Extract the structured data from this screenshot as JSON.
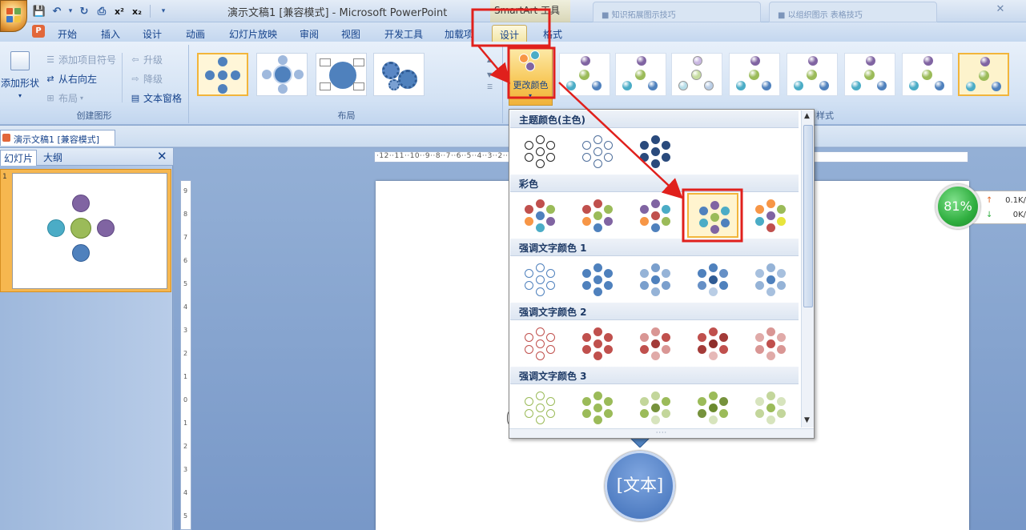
{
  "window": {
    "title": "演示文稿1 [兼容模式] - Microsoft PowerPoint",
    "contextual_title": "SmartArt 工具",
    "bg_tab_1": "■ 知识拓展图示技巧",
    "bg_tab_2": "■ 以组织图示 表格技巧",
    "close_glyph": "✕"
  },
  "qat": {
    "save": "💾",
    "undo": "↶",
    "redo": "↻",
    "superscript": "x²",
    "subscript": "x₂",
    "dropdown": "▾"
  },
  "office_logo_colors": [
    "#e05b2a",
    "#6aa84f",
    "#3d78c7",
    "#f3c340"
  ],
  "ppt_badge": "P",
  "tabs": [
    {
      "label": "开始"
    },
    {
      "label": "插入"
    },
    {
      "label": "设计"
    },
    {
      "label": "动画"
    },
    {
      "label": "幻灯片放映"
    },
    {
      "label": "审阅"
    },
    {
      "label": "视图"
    },
    {
      "label": "开发工具"
    },
    {
      "label": "加载项"
    },
    {
      "label": "设计"
    },
    {
      "label": "格式"
    }
  ],
  "ribbon": {
    "create_group": {
      "label": "创建图形",
      "add_shape": "添加形状",
      "add_bullet": "添加项目符号",
      "right_to_left": "从右向左",
      "layout": "布局",
      "promote": "升级",
      "demote": "降级",
      "text_pane": "文本窗格"
    },
    "layouts_group": {
      "label": "布局"
    },
    "styles_group": {
      "label": "SmartArt 样式",
      "label_visible": "样式"
    },
    "change_color": "更改颜色"
  },
  "document_tab": "演示文稿1 [兼容模式]",
  "pane": {
    "tab_slides": "幻灯片",
    "tab_outline": "大纲",
    "close": "✕",
    "slide_number": "1"
  },
  "ruler": {
    "horizontal": "·12··11··10··9··8··7··6··5··4··3··2··1··0··1··2··3··4··5··6··7··8··9··10··11··12·"
  },
  "slide": {
    "bubble_text": "[文本]"
  },
  "gallery": {
    "sections": [
      {
        "title": "主题颜色(主色)"
      },
      {
        "title": "彩色"
      },
      {
        "title": "强调文字颜色 1"
      },
      {
        "title": "强调文字颜色 2"
      },
      {
        "title": "强调文字颜色 3"
      }
    ],
    "palettes": {
      "theme": [
        {
          "center": "#ffffff",
          "ring": [
            "#ffffff",
            "#ffffff",
            "#ffffff",
            "#ffffff",
            "#ffffff",
            "#ffffff"
          ],
          "stroke": "#222222"
        },
        {
          "center": "#ffffff",
          "ring": [
            "#ffffff",
            "#ffffff",
            "#ffffff",
            "#ffffff",
            "#ffffff",
            "#ffffff"
          ],
          "stroke": "#4f6f9c"
        },
        {
          "center": "#2a4a7c",
          "ring": [
            "#2a4a7c",
            "#2a4a7c",
            "#2a4a7c",
            "#2a4a7c",
            "#2a4a7c",
            "#2a4a7c"
          ],
          "stroke": "#2a4a7c"
        }
      ],
      "colorful": [
        {
          "center": "#4f81bd",
          "ring": [
            "#c0504d",
            "#9bbb59",
            "#8064a2",
            "#4bacc6",
            "#f79646",
            "#c0504d"
          ],
          "stroke": "none"
        },
        {
          "center": "#9bbb59",
          "ring": [
            "#c0504d",
            "#9bbb59",
            "#8064a2",
            "#4f81bd",
            "#f79646",
            "#c0504d"
          ],
          "stroke": "none"
        },
        {
          "center": "#c0504d",
          "ring": [
            "#8064a2",
            "#4bacc6",
            "#9bbb59",
            "#4f81bd",
            "#f79646",
            "#8064a2"
          ],
          "stroke": "none"
        },
        {
          "center": "#9bbb59",
          "ring": [
            "#8064a2",
            "#4bacc6",
            "#4f81bd",
            "#8064a2",
            "#4bacc6",
            "#4f81bd"
          ],
          "stroke": "none"
        },
        {
          "center": "#8064a2",
          "ring": [
            "#f79646",
            "#9bbb59",
            "#e8e53c",
            "#c0504d",
            "#4bacc6",
            "#f79646"
          ],
          "stroke": "none"
        }
      ],
      "accent1": [
        {
          "center": "#ffffff",
          "ring": [
            "#ffffff",
            "#ffffff",
            "#ffffff",
            "#ffffff",
            "#ffffff",
            "#ffffff"
          ],
          "stroke": "#4f81bd"
        },
        {
          "center": "#4f81bd",
          "ring": [
            "#4f81bd",
            "#4f81bd",
            "#4f81bd",
            "#4f81bd",
            "#4f81bd",
            "#4f81bd"
          ],
          "stroke": "none"
        },
        {
          "center": "#4f81bd",
          "ring": [
            "#7a9fcd",
            "#95b3d7",
            "#7a9fcd",
            "#95b3d7",
            "#7a9fcd",
            "#95b3d7"
          ],
          "stroke": "none"
        },
        {
          "center": "#2f5b94",
          "ring": [
            "#4f81bd",
            "#6690c6",
            "#4f81bd",
            "#b9cde5",
            "#6690c6",
            "#4f81bd"
          ],
          "stroke": "none"
        },
        {
          "center": "#4f81bd",
          "ring": [
            "#95b3d7",
            "#a7c0de",
            "#95b3d7",
            "#a7c0de",
            "#95b3d7",
            "#a7c0de"
          ],
          "stroke": "none"
        }
      ],
      "accent2": [
        {
          "center": "#ffffff",
          "ring": [
            "#ffffff",
            "#ffffff",
            "#ffffff",
            "#ffffff",
            "#ffffff",
            "#ffffff"
          ],
          "stroke": "#c0504d"
        },
        {
          "center": "#c0504d",
          "ring": [
            "#c0504d",
            "#c0504d",
            "#c0504d",
            "#c0504d",
            "#c0504d",
            "#c0504d"
          ],
          "stroke": "none"
        },
        {
          "center": "#a33b38",
          "ring": [
            "#d99694",
            "#c0504d",
            "#d99694",
            "#e0aaa8",
            "#c0504d",
            "#d99694"
          ],
          "stroke": "none"
        },
        {
          "center": "#8e2e2b",
          "ring": [
            "#c0504d",
            "#a33b38",
            "#c0504d",
            "#e6b9b8",
            "#a33b38",
            "#c0504d"
          ],
          "stroke": "none"
        },
        {
          "center": "#c0504d",
          "ring": [
            "#d99694",
            "#e0aaa8",
            "#d99694",
            "#e0aaa8",
            "#d99694",
            "#e0aaa8"
          ],
          "stroke": "none"
        }
      ],
      "accent3": [
        {
          "center": "#ffffff",
          "ring": [
            "#ffffff",
            "#ffffff",
            "#ffffff",
            "#ffffff",
            "#ffffff",
            "#ffffff"
          ],
          "stroke": "#9bbb59"
        },
        {
          "center": "#9bbb59",
          "ring": [
            "#9bbb59",
            "#9bbb59",
            "#9bbb59",
            "#9bbb59",
            "#9bbb59",
            "#9bbb59"
          ],
          "stroke": "none"
        },
        {
          "center": "#76923c",
          "ring": [
            "#c3d69b",
            "#9bbb59",
            "#c3d69b",
            "#d7e4bd",
            "#9bbb59",
            "#c3d69b"
          ],
          "stroke": "none"
        },
        {
          "center": "#6b8a2f",
          "ring": [
            "#9bbb59",
            "#76923c",
            "#9bbb59",
            "#d7e4bd",
            "#76923c",
            "#9bbb59"
          ],
          "stroke": "none"
        },
        {
          "center": "#9bbb59",
          "ring": [
            "#c3d69b",
            "#d7e4bd",
            "#c3d69b",
            "#d7e4bd",
            "#c3d69b",
            "#d7e4bd"
          ],
          "stroke": "none"
        }
      ]
    },
    "scroll_up": "▲",
    "scroll_down": "▼",
    "grip": "····"
  },
  "net_widget": {
    "percent": "81%",
    "upload": "0.1K/",
    "download": "0K/",
    "up_arrow": "↑",
    "down_arrow": "↓"
  },
  "colors": {
    "highlight_red": "#e0201c",
    "accent_orange": "#f2b53b"
  }
}
